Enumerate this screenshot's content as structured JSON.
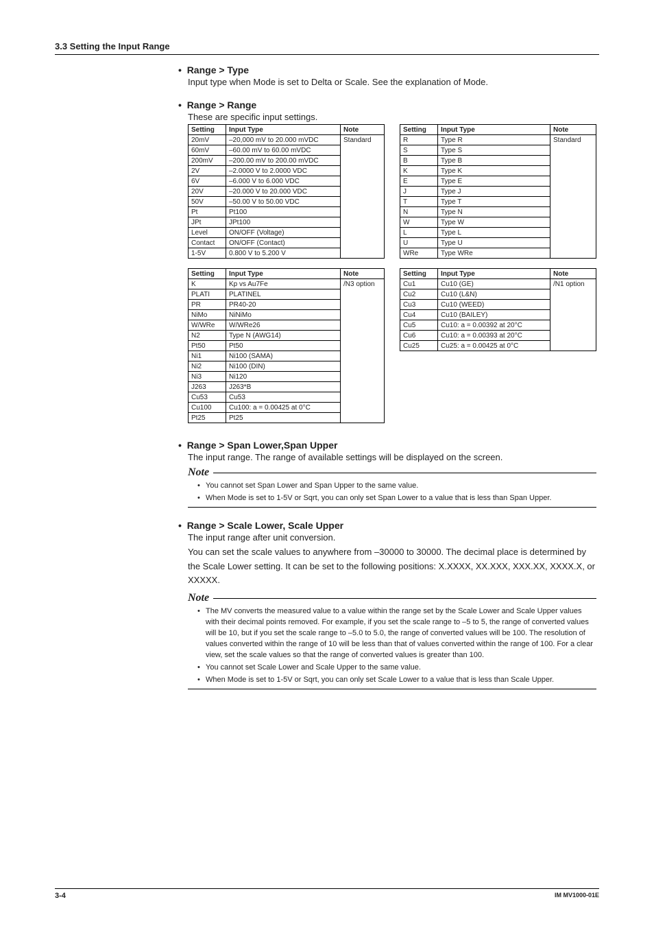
{
  "header": {
    "title": "3.3  Setting the Input Range"
  },
  "s1": {
    "head": "Range >  Type",
    "desc": "Input type when Mode is set to Delta or Scale. See the explanation of Mode."
  },
  "s2": {
    "head": "Range >  Range",
    "desc": "These are specific input settings."
  },
  "th": {
    "setting": "Setting",
    "type": "Input Type",
    "note": "Note"
  },
  "t1": {
    "note": "Standard",
    "rows": [
      {
        "s": "20mV",
        "t": "–20,000 mV to 20.000 mVDC"
      },
      {
        "s": "60mV",
        "t": "–60.00 mV to 60.00 mVDC"
      },
      {
        "s": "200mV",
        "t": "–200.00 mV to 200.00 mVDC"
      },
      {
        "s": "2V",
        "t": "–2.0000 V to 2.0000 VDC"
      },
      {
        "s": "6V",
        "t": "–6.000 V to 6.000 VDC"
      },
      {
        "s": "20V",
        "t": "–20.000 V to 20.000 VDC"
      },
      {
        "s": "50V",
        "t": "–50.00 V to 50.00 VDC"
      },
      {
        "s": "Pt",
        "t": "Pt100"
      },
      {
        "s": "JPt",
        "t": "JPt100"
      },
      {
        "s": "Level",
        "t": "ON/OFF (Voltage)"
      },
      {
        "s": "Contact",
        "t": "ON/OFF (Contact)"
      },
      {
        "s": "1-5V",
        "t": "0.800 V to 5.200 V"
      }
    ]
  },
  "t2": {
    "note": "Standard",
    "rows": [
      {
        "s": "R",
        "t": "Type R"
      },
      {
        "s": "S",
        "t": "Type S"
      },
      {
        "s": "B",
        "t": "Type B"
      },
      {
        "s": "K",
        "t": "Type K"
      },
      {
        "s": "E",
        "t": "Type E"
      },
      {
        "s": "J",
        "t": "Type J"
      },
      {
        "s": "T",
        "t": "Type T"
      },
      {
        "s": "N",
        "t": "Type N"
      },
      {
        "s": "W",
        "t": "Type W"
      },
      {
        "s": "L",
        "t": "Type L"
      },
      {
        "s": "U",
        "t": "Type U"
      },
      {
        "s": "WRe",
        "t": "Type WRe"
      }
    ]
  },
  "t3": {
    "note": "/N3 option",
    "rows": [
      {
        "s": "K",
        "t": "Kp vs Au7Fe"
      },
      {
        "s": "PLATI",
        "t": "PLATINEL"
      },
      {
        "s": "PR",
        "t": "PR40-20"
      },
      {
        "s": "NiMo",
        "t": "NiNiMo"
      },
      {
        "s": "W/WRe",
        "t": "W/WRe26"
      },
      {
        "s": "N2",
        "t": "Type N (AWG14)"
      },
      {
        "s": "Pt50",
        "t": "Pt50"
      },
      {
        "s": "Ni1",
        "t": "Ni100 (SAMA)"
      },
      {
        "s": "Ni2",
        "t": "Ni100 (DIN)"
      },
      {
        "s": "Ni3",
        "t": "Ni120"
      },
      {
        "s": "J263",
        "t": "J263*B"
      },
      {
        "s": "Cu53",
        "t": "Cu53"
      },
      {
        "s": "Cu100",
        "t": "Cu100: a = 0.00425 at 0°C"
      },
      {
        "s": "Pt25",
        "t": "Pt25"
      }
    ]
  },
  "t4": {
    "note": "/N1 option",
    "rows": [
      {
        "s": "Cu1",
        "t": "Cu10 (GE)"
      },
      {
        "s": "Cu2",
        "t": "Cu10 (L&N)"
      },
      {
        "s": "Cu3",
        "t": "Cu10 (WEED)"
      },
      {
        "s": "Cu4",
        "t": "Cu10 (BAILEY)"
      },
      {
        "s": "Cu5",
        "t": "Cu10: a = 0.00392 at 20°C"
      },
      {
        "s": "Cu6",
        "t": "Cu10: a = 0.00393 at 20°C"
      },
      {
        "s": "Cu25",
        "t": "Cu25: a = 0.00425 at 0°C"
      }
    ]
  },
  "s3": {
    "head": "Range > Span Lower,Span Upper",
    "desc": "The input range. The range of available settings will be displayed on the screen."
  },
  "note1": {
    "label": "Note",
    "items": [
      "You cannot set Span Lower and Span Upper to the same value.",
      "When Mode is set to 1-5V or Sqrt, you can only set Span Lower to a value that is less than Span Upper."
    ]
  },
  "s4": {
    "head": "Range > Scale Lower, Scale Upper",
    "p1": "The input range after unit conversion.",
    "p2": "You can set the scale values to anywhere from –30000 to 30000. The decimal place is determined by the Scale Lower setting. It can be set to the following positions: X.XXXX, XX.XXX, XXX.XX, XXXX.X, or XXXXX."
  },
  "note2": {
    "label": "Note",
    "items": [
      "The MV converts the measured value to a value within the range set by the Scale Lower and Scale Upper values with their decimal points removed. For example, if you set the scale range to –5 to 5,  the range of converted values will be 10, but if you set the scale range to –5.0 to 5.0, the range of converted values will be 100. The resolution of values converted within the range of 10 will be less than that of values converted within the range of 100. For a clear view, set the scale values so that the range of converted values is greater than 100.",
      "You cannot set Scale Lower and Scale Upper to the same value.",
      "When Mode is set to 1-5V or Sqrt, you can only set Scale Lower to a value that is less than Scale Upper."
    ]
  },
  "footer": {
    "page": "3-4",
    "doc": "IM MV1000-01E"
  }
}
